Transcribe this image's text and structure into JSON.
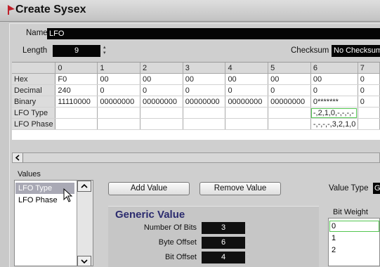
{
  "window": {
    "title": "Create Sysex"
  },
  "form": {
    "name_label": "Name",
    "name_value": "LFO",
    "length_label": "Length",
    "length_value": "9",
    "checksum_label": "Checksum",
    "checksum_value": "No Checksum"
  },
  "grid": {
    "columns": [
      "",
      "0",
      "1",
      "2",
      "3",
      "4",
      "5",
      "6",
      "7"
    ],
    "rows": [
      {
        "label": "Hex",
        "cells": [
          "F0",
          "00",
          "00",
          "00",
          "00",
          "00",
          "00",
          "0"
        ]
      },
      {
        "label": "Decimal",
        "cells": [
          "240",
          "0",
          "0",
          "0",
          "0",
          "0",
          "0",
          "0"
        ]
      },
      {
        "label": "Binary",
        "cells": [
          "11110000",
          "00000000",
          "00000000",
          "00000000",
          "00000000",
          "00000000",
          "0*******",
          "0"
        ]
      },
      {
        "label": "LFO Type",
        "cells": [
          "",
          "",
          "",
          "",
          "",
          "",
          "-,2,1,0,-,-,-,-",
          ""
        ]
      },
      {
        "label": "LFO Phase",
        "cells": [
          "",
          "",
          "",
          "",
          "",
          "",
          "-,-,-,-,3,2,1,0",
          ""
        ]
      }
    ]
  },
  "values": {
    "label": "Values",
    "items": [
      "LFO Type",
      "LFO Phase"
    ],
    "selected": "LFO Type"
  },
  "buttons": {
    "add_value": "Add Value",
    "remove_value": "Remove Value"
  },
  "value_type": {
    "label": "Value Type",
    "value": "G"
  },
  "generic": {
    "title": "Generic Value",
    "number_of_bits_label": "Number Of Bits",
    "number_of_bits": "3",
    "byte_offset_label": "Byte Offset",
    "byte_offset": "6",
    "bit_offset_label": "Bit Offset",
    "bit_offset": "4"
  },
  "bit_weight": {
    "label": "Bit Weight",
    "items": [
      "0",
      "1",
      "2"
    ]
  },
  "colors": {
    "highlight": "#53c651",
    "title_accent": "#2b2b6e",
    "logo": "#c0202a"
  }
}
